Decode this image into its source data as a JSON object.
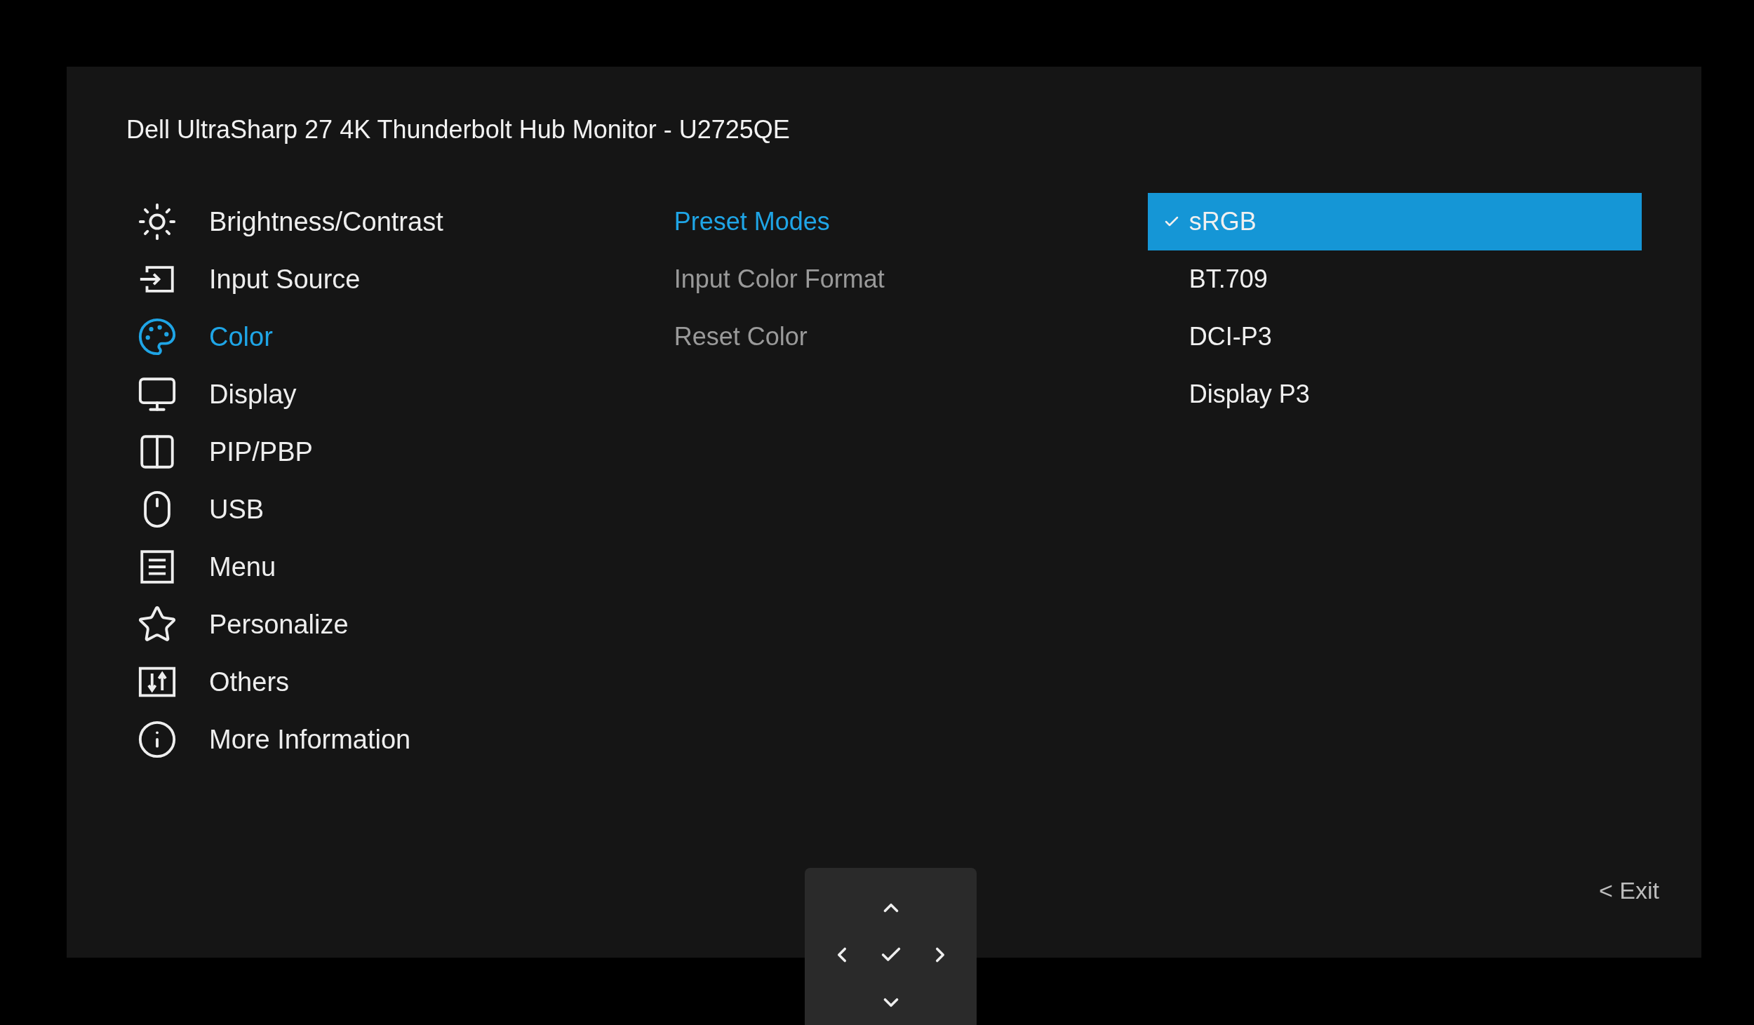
{
  "window": {
    "title": "Dell UltraSharp 27 4K Thunderbolt Hub Monitor - U2725QE"
  },
  "menu": {
    "items": [
      {
        "label": "Brightness/Contrast",
        "selected": false
      },
      {
        "label": "Input Source",
        "selected": false
      },
      {
        "label": "Color",
        "selected": true
      },
      {
        "label": "Display",
        "selected": false
      },
      {
        "label": "PIP/PBP",
        "selected": false
      },
      {
        "label": "USB",
        "selected": false
      },
      {
        "label": "Menu",
        "selected": false
      },
      {
        "label": "Personalize",
        "selected": false
      },
      {
        "label": "Others",
        "selected": false
      },
      {
        "label": "More Information",
        "selected": false
      }
    ]
  },
  "submenu": {
    "items": [
      {
        "label": "Preset Modes",
        "selected": true
      },
      {
        "label": "Input Color Format",
        "selected": false
      },
      {
        "label": "Reset Color",
        "selected": false
      }
    ]
  },
  "options": {
    "items": [
      {
        "label": "sRGB",
        "selected": true
      },
      {
        "label": "BT.709",
        "selected": false
      },
      {
        "label": "DCI-P3",
        "selected": false
      },
      {
        "label": "Display P3",
        "selected": false
      }
    ]
  },
  "exit": "< Exit"
}
